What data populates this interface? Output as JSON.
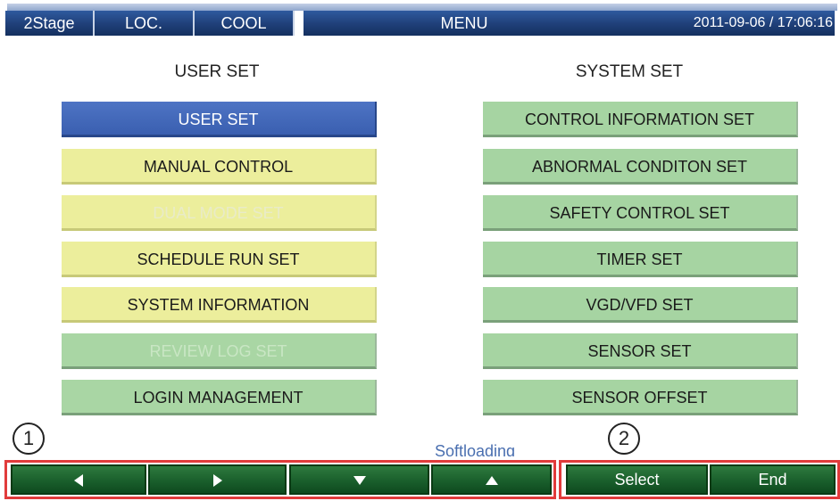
{
  "header": {
    "stage": "2Stage",
    "location": "LOC.",
    "mode": "COOL",
    "title": "MENU",
    "datetime": "2011-09-06 / 17:06:16"
  },
  "user_set": {
    "title": "USER SET",
    "items": [
      {
        "label": "USER SET",
        "state": "selected"
      },
      {
        "label": "MANUAL CONTROL",
        "state": "enabled"
      },
      {
        "label": "DUAL MODE SET",
        "state": "disabled"
      },
      {
        "label": "SCHEDULE RUN SET",
        "state": "enabled"
      },
      {
        "label": "SYSTEM INFORMATION",
        "state": "enabled"
      },
      {
        "label": "REVIEW LOG SET",
        "state": "disabled"
      },
      {
        "label": "LOGIN MANAGEMENT",
        "state": "enabled"
      }
    ]
  },
  "system_set": {
    "title": "SYSTEM SET",
    "items": [
      {
        "label": "CONTROL INFORMATION SET"
      },
      {
        "label": "ABNORMAL CONDITON SET"
      },
      {
        "label": "SAFETY CONTROL SET"
      },
      {
        "label": "TIMER SET"
      },
      {
        "label": "VGD/VFD SET"
      },
      {
        "label": "SENSOR SET"
      },
      {
        "label": "SENSOR OFFSET"
      }
    ]
  },
  "status": {
    "text": "Softloading"
  },
  "markers": {
    "one": "1",
    "two": "2"
  },
  "footer": {
    "nav_icons": [
      "left-arrow-icon",
      "right-arrow-icon",
      "down-arrow-icon",
      "up-arrow-icon"
    ],
    "select_label": "Select",
    "end_label": "End"
  },
  "colors": {
    "header_blue": "#1f3f78",
    "selected_blue": "#3a5fb0",
    "yellow_button": "#ecee9c",
    "green_button": "#a9d6a4",
    "footer_green": "#1a5f2c",
    "highlight_red": "#e13b3b",
    "status_blue": "#4a6fb0"
  }
}
